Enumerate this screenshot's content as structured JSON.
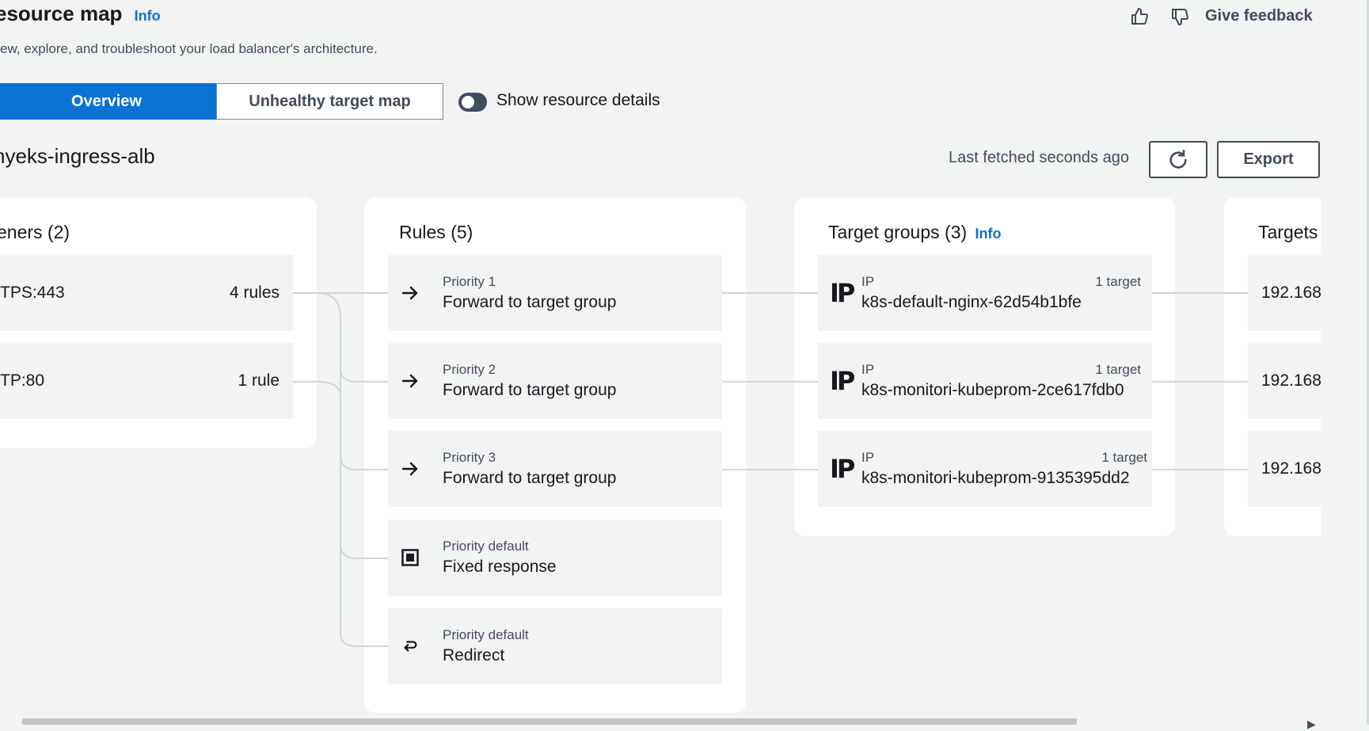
{
  "header": {
    "title": "esource map",
    "info": "Info",
    "subtitle": "ew, explore, and troubleshoot your load balancer's architecture.",
    "feedback": "Give feedback"
  },
  "tabs": {
    "overview": "Overview",
    "unhealthy": "Unhealthy target map"
  },
  "toggle": {
    "label": "Show resource details",
    "on": false
  },
  "lb": {
    "name": "nyeks-ingress-alb"
  },
  "toolbar": {
    "last_fetched": "Last fetched seconds ago",
    "export": "Export"
  },
  "listeners": {
    "title": "eners (2)",
    "items": [
      {
        "name": "TPS:443",
        "rules": "4 rules"
      },
      {
        "name": "TP:80",
        "rules": "1 rule"
      }
    ]
  },
  "rules": {
    "title": "Rules (5)",
    "items": [
      {
        "priority": "Priority 1",
        "action": "Forward to target group",
        "icon": "arrow-right-icon"
      },
      {
        "priority": "Priority 2",
        "action": "Forward to target group",
        "icon": "arrow-right-icon"
      },
      {
        "priority": "Priority 3",
        "action": "Forward to target group",
        "icon": "arrow-right-icon"
      },
      {
        "priority": "Priority default",
        "action": "Fixed response",
        "icon": "fixed-response-icon"
      },
      {
        "priority": "Priority default",
        "action": "Redirect",
        "icon": "redirect-icon"
      }
    ]
  },
  "target_groups": {
    "title": "Target groups (3)",
    "info": "Info",
    "items": [
      {
        "type": "IP",
        "count": "1 target",
        "name": "k8s-default-nginx-62d54b1bfe"
      },
      {
        "type": "IP",
        "count": "1 target",
        "name": "k8s-monitori-kubeprom-2ce617fdb0"
      },
      {
        "type": "IP",
        "count": "1 target",
        "name": "k8s-monitori-kubeprom-9135395dd2"
      }
    ]
  },
  "targets": {
    "title": "Targets",
    "items": [
      {
        "ip": "192.168"
      },
      {
        "ip": "192.168"
      },
      {
        "ip": "192.168"
      }
    ]
  },
  "ip_glyph": "IP"
}
